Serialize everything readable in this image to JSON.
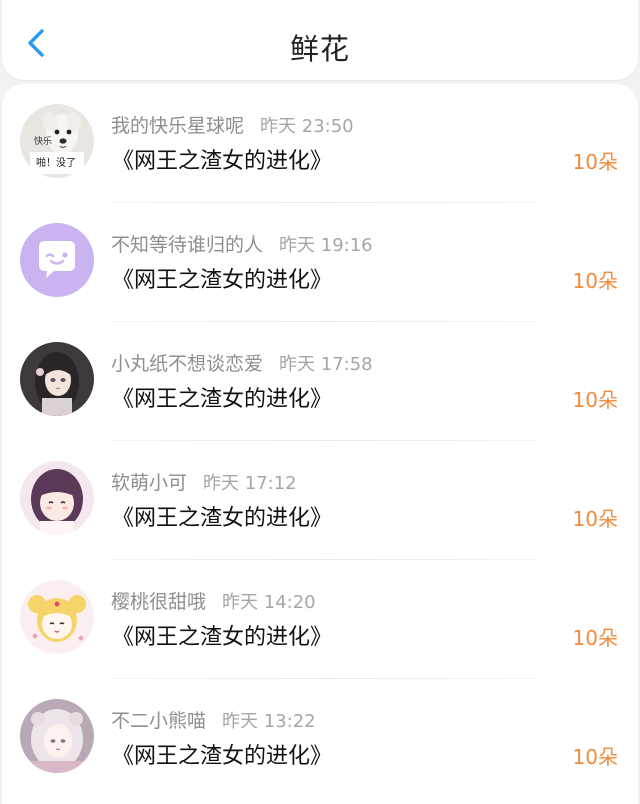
{
  "header": {
    "title": "鲜花",
    "accent_color": "#2a9bf2"
  },
  "records": [
    {
      "name": "我的快乐星球呢",
      "time": "昨天 23:50",
      "book": "《网王之渣女的进化》",
      "amount": "10朵",
      "avatar": "dog-meme-avatar",
      "avatar_text": "快乐 啪！没了"
    },
    {
      "name": "不知等待谁归的人",
      "time": "昨天 19:16",
      "book": "《网王之渣女的进化》",
      "amount": "10朵",
      "avatar": "default-chat-avatar"
    },
    {
      "name": "小丸纸不想谈恋爱",
      "time": "昨天 17:58",
      "book": "《网王之渣女的进化》",
      "amount": "10朵",
      "avatar": "anime-girl-dark-hair-avatar"
    },
    {
      "name": "软萌小可",
      "time": "昨天 17:12",
      "book": "《网王之渣女的进化》",
      "amount": "10朵",
      "avatar": "anime-girl-purple-avatar"
    },
    {
      "name": "樱桃很甜哦",
      "time": "昨天 14:20",
      "book": "《网王之渣女的进化》",
      "amount": "10朵",
      "avatar": "sailor-moon-avatar"
    },
    {
      "name": "不二小熊喵",
      "time": "昨天 13:22",
      "book": "《网王之渣女的进化》",
      "amount": "10朵",
      "avatar": "anime-girl-white-hair-avatar"
    }
  ],
  "colors": {
    "amount": "#f28a3c",
    "name": "#8e8e93",
    "book": "#111111"
  }
}
